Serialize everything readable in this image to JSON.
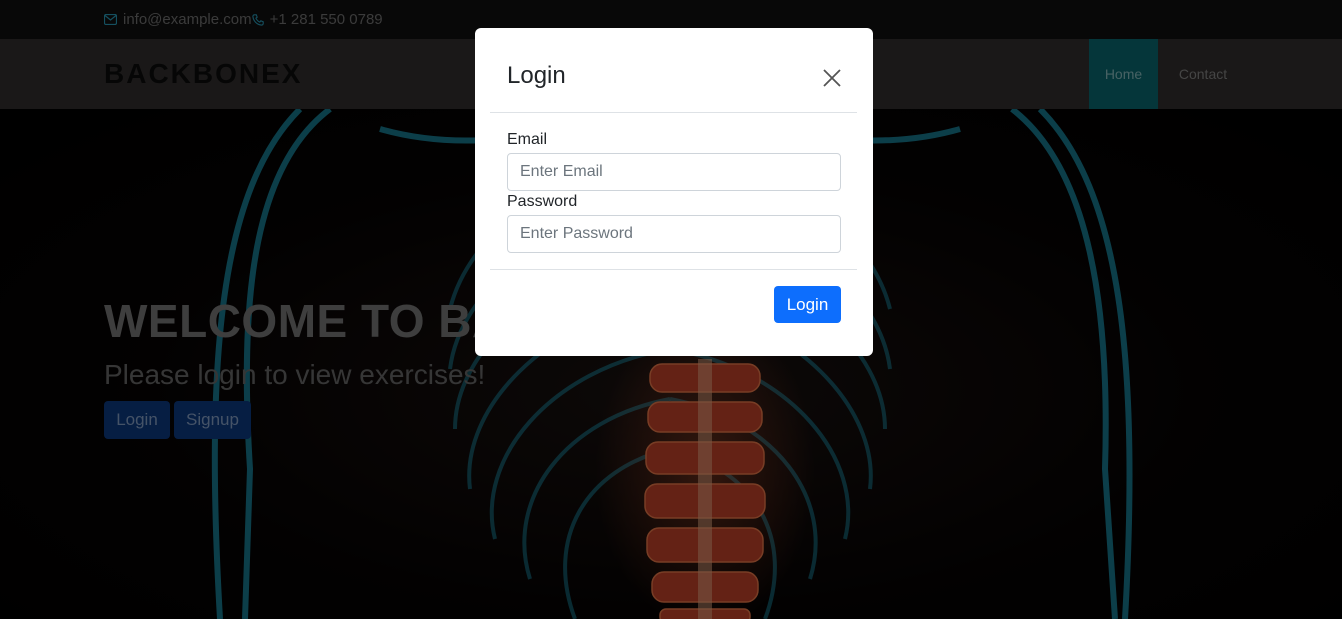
{
  "topbar": {
    "email": "info@example.com",
    "phone": "+1 281 550 0789",
    "email_icon": "mail-icon",
    "phone_icon": "phone-icon"
  },
  "navbar": {
    "brand": "BACKBONEX",
    "items": [
      {
        "label": "Home",
        "active": true
      },
      {
        "label": "Contact",
        "active": false
      }
    ]
  },
  "hero": {
    "title": "WELCOME TO BACKBONEX",
    "subtitle": "Please login to view exercises!",
    "login_label": "Login",
    "signup_label": "Signup"
  },
  "modal": {
    "title": "Login",
    "close_icon": "close-icon",
    "email_label": "Email",
    "email_placeholder": "Enter Email",
    "password_label": "Password",
    "password_placeholder": "Enter Password",
    "submit_label": "Login"
  },
  "colors": {
    "topbar_bg": "#111111",
    "navbar_bg": "#343130",
    "nav_active_bg": "#0b6c74",
    "primary": "#0d6efd",
    "hero_button": "#0d3c86",
    "skeleton_glow": "#1fa6c4",
    "spine": "#d8482a"
  }
}
